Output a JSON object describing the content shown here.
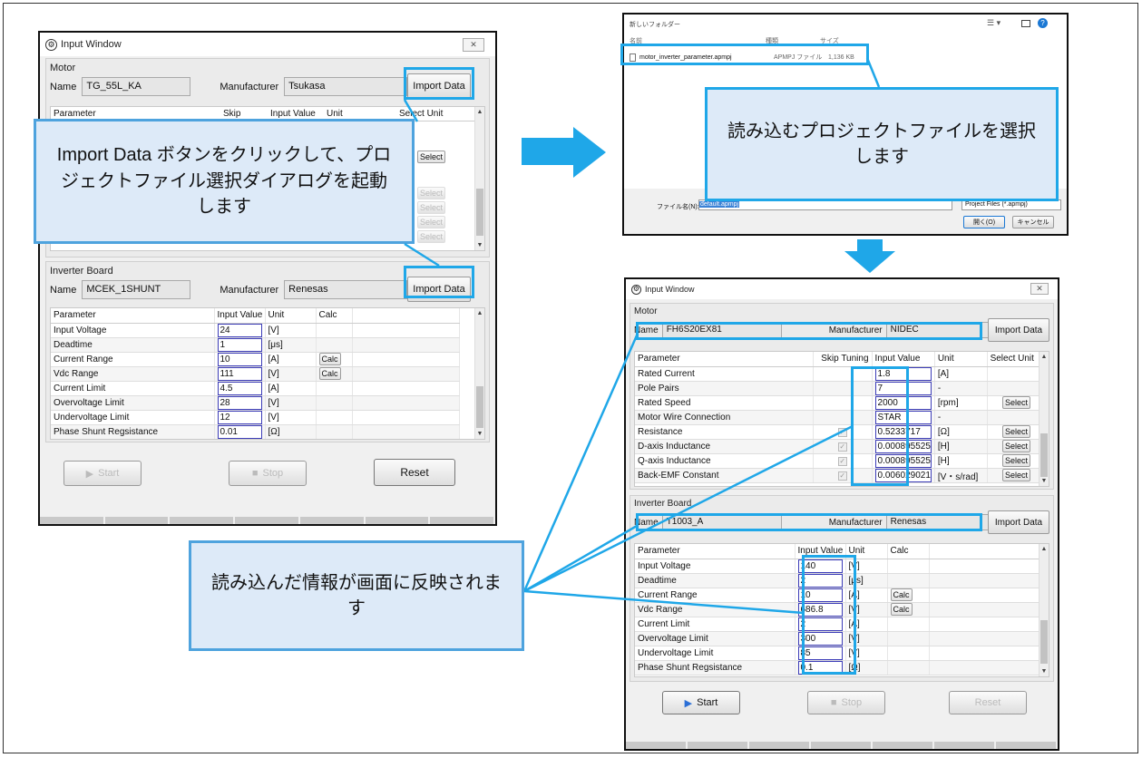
{
  "left_window": {
    "title": "Input Window",
    "motor": {
      "section": "Motor",
      "name_label": "Name",
      "name": "TG_55L_KA",
      "manufacturer_label": "Manufacturer",
      "manufacturer": "Tsukasa",
      "import_label": "Import Data",
      "headers": [
        "Parameter",
        "Skip Tuning",
        "Input Value",
        "Unit",
        "Select Unit"
      ],
      "select_labels": [
        "Select",
        "Select",
        "Select",
        "Select",
        "Select"
      ]
    },
    "inverter": {
      "section": "Inverter Board",
      "name_label": "Name",
      "name": "MCEK_1SHUNT",
      "manufacturer_label": "Manufacturer",
      "manufacturer": "Renesas",
      "import_label": "Import Data",
      "headers": [
        "Parameter",
        "Input Value",
        "Unit",
        "Calc"
      ],
      "rows": [
        {
          "param": "Input Voltage",
          "value": "24",
          "unit": "[V]",
          "calc": ""
        },
        {
          "param": "Deadtime",
          "value": "1",
          "unit": "[μs]",
          "calc": ""
        },
        {
          "param": "Current Range",
          "value": "10",
          "unit": "[A]",
          "calc": "Calc"
        },
        {
          "param": "Vdc Range",
          "value": "111",
          "unit": "[V]",
          "calc": "Calc"
        },
        {
          "param": "Current Limit",
          "value": "4.5",
          "unit": "[A]",
          "calc": ""
        },
        {
          "param": "Overvoltage Limit",
          "value": "28",
          "unit": "[V]",
          "calc": ""
        },
        {
          "param": "Undervoltage Limit",
          "value": "12",
          "unit": "[V]",
          "calc": ""
        },
        {
          "param": "Phase Shunt Regsistance",
          "value": "0.01",
          "unit": "[Ω]",
          "calc": ""
        }
      ]
    },
    "start": "Start",
    "stop": "Stop",
    "reset": "Reset"
  },
  "callout_import": "Import Data ボタンをクリックして、プロジェクトファイル選択ダイアログを起動します",
  "file_dialog": {
    "folder": "新しいフォルダー",
    "col_name": "名前",
    "col_type": "種類",
    "col_size": "サイズ",
    "file_name": "motor_inverter_parameter.apmpj",
    "file_type": "APMPJ ファイル",
    "file_size": "1,136 KB",
    "filename_label": "ファイル名(N):",
    "filename_value": "default.apmpj",
    "filter": "Project Files (*.apmpj)",
    "open": "開く(O)",
    "cancel": "キャンセル"
  },
  "callout_select": "読み込むプロジェクトファイルを選択します",
  "callout_reflect": "読み込んだ情報が画面に反映されます",
  "right_window": {
    "title": "Input Window",
    "motor": {
      "section": "Motor",
      "name_label": "Name",
      "name": "FH6S20EX81",
      "manufacturer_label": "Manufacturer",
      "manufacturer": "NIDEC",
      "import_label": "Import Data",
      "headers": [
        "Parameter",
        "Skip Tuning",
        "Input Value",
        "Unit",
        "Select Unit"
      ],
      "rows": [
        {
          "param": "Rated Current",
          "skip": false,
          "value": "1.8",
          "unit": "[A]",
          "select": ""
        },
        {
          "param": "Pole Pairs",
          "skip": false,
          "value": "7",
          "unit": "-",
          "select": ""
        },
        {
          "param": "Rated Speed",
          "skip": false,
          "value": "2000",
          "unit": "[rpm]",
          "select": "Select"
        },
        {
          "param": "Motor Wire Connection",
          "skip": false,
          "value": "STAR",
          "unit": "-",
          "select": ""
        },
        {
          "param": "Resistance",
          "skip": true,
          "value": "0.5233717",
          "unit": "[Ω]",
          "select": "Select"
        },
        {
          "param": "D-axis Inductance",
          "skip": true,
          "value": "0.000895525",
          "unit": "[H]",
          "select": "Select"
        },
        {
          "param": "Q-axis Inductance",
          "skip": true,
          "value": "0.000895525",
          "unit": "[H]",
          "select": "Select"
        },
        {
          "param": "Back-EMF Constant",
          "skip": true,
          "value": "0.006029021",
          "unit": "[V・s/rad]",
          "select": "Select"
        }
      ]
    },
    "inverter": {
      "section": "Inverter Board",
      "name_label": "Name",
      "name": "T1003_A",
      "manufacturer_label": "Manufacturer",
      "manufacturer": "Renesas",
      "import_label": "Import Data",
      "headers": [
        "Parameter",
        "Input Value",
        "Unit",
        "Calc"
      ],
      "rows": [
        {
          "param": "Input Voltage",
          "value": "140",
          "unit": "[V]",
          "calc": ""
        },
        {
          "param": "Deadtime",
          "value": "2",
          "unit": "[μs]",
          "calc": ""
        },
        {
          "param": "Current Range",
          "value": "10",
          "unit": "[A]",
          "calc": "Calc"
        },
        {
          "param": "Vdc Range",
          "value": "686.8",
          "unit": "[V]",
          "calc": "Calc"
        },
        {
          "param": "Current Limit",
          "value": "2",
          "unit": "[A]",
          "calc": ""
        },
        {
          "param": "Overvoltage Limit",
          "value": "300",
          "unit": "[V]",
          "calc": ""
        },
        {
          "param": "Undervoltage Limit",
          "value": "85",
          "unit": "[V]",
          "calc": ""
        },
        {
          "param": "Phase Shunt Regsistance",
          "value": "0.1",
          "unit": "[Ω]",
          "calc": ""
        }
      ]
    },
    "start": "Start",
    "stop": "Stop",
    "reset": "Reset"
  },
  "colors": {
    "highlight": "#1fa7e8",
    "callout_fill": "#ddeaf8",
    "callout_border": "#4ea3de",
    "window_bg": "#f0f0f0"
  }
}
